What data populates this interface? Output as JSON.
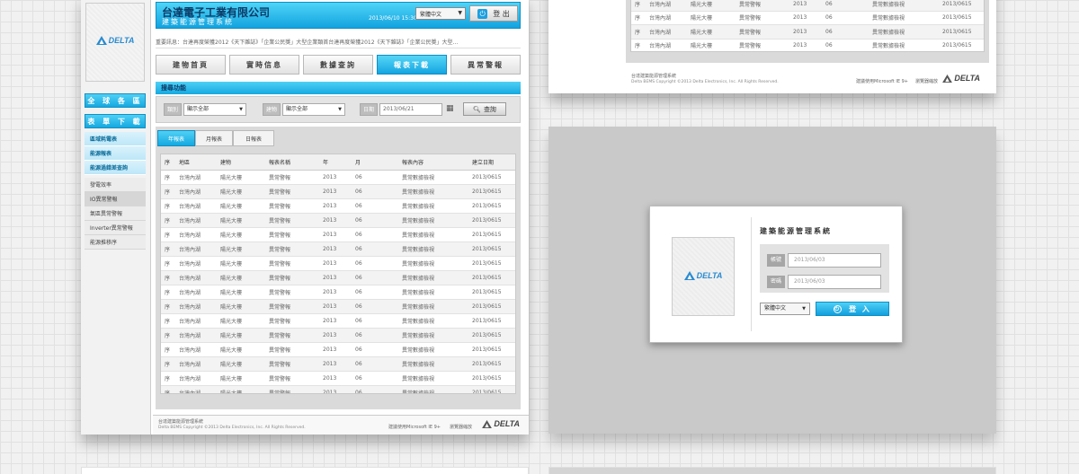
{
  "brand": {
    "logo_text": "DELTA",
    "accent": "#1aaae2",
    "dark_text": "#0b3a66"
  },
  "header": {
    "company": "台達電子工業有限公司",
    "system": "建築能源管理系統",
    "datetime": "2013/06/10  15:30",
    "language": "繁體中文",
    "logout": "登 出"
  },
  "marquee": "重要訊息：台達再度榮獲2012《天下雜誌》「企業公民獎」大型企業類首台達再度榮獲2012《天下雜誌》「企業公民獎」大型...",
  "nav": [
    "建物首頁",
    "實時信息",
    "數據查詢",
    "報表下載",
    "異常警報"
  ],
  "sidebar": {
    "region": "全 球 各 區",
    "reports": "表 單 下 載",
    "items": [
      "區域耗電表",
      "能源報表",
      "能源過錯差查詢",
      "發電效率",
      "IO異常警報",
      "氣區異常警報",
      "Inverter異常警報",
      "能源推移序"
    ]
  },
  "search": {
    "title": "搜尋功能",
    "label1": "類別",
    "select1": "顯示全部",
    "label2": "建物",
    "select2": "顯示全部",
    "label3": "日期",
    "date": "2013/06/21",
    "button": "查詢"
  },
  "tabs": [
    "年報表",
    "月報表",
    "日報表"
  ],
  "table": {
    "headers": [
      "序",
      "地區",
      "建物",
      "報表名稱",
      "年",
      "月",
      "報表內容",
      "建立日期"
    ],
    "row": [
      "序",
      "台灣內湖",
      "陽光大樓",
      "異常警報",
      "2013",
      "06",
      "異常數據檢視",
      "2013/0615"
    ]
  },
  "footer": {
    "line1": "台達建築能源管理系統",
    "line2": "Delta BEMS Copyright ©2013 Delta Electronics, Inc. All Rights Reserved.",
    "browser": "建議使用Microsoft IE 9+",
    "credit": "瀏覽器縮放",
    "logo": "DELTA"
  },
  "login": {
    "title": "建築能源管理系統",
    "account_label": "帳號",
    "account_value": "2013/06/03",
    "password_label": "密碼",
    "password_value": "2013/06/03",
    "language": "繁體中文",
    "button": "登 入"
  }
}
